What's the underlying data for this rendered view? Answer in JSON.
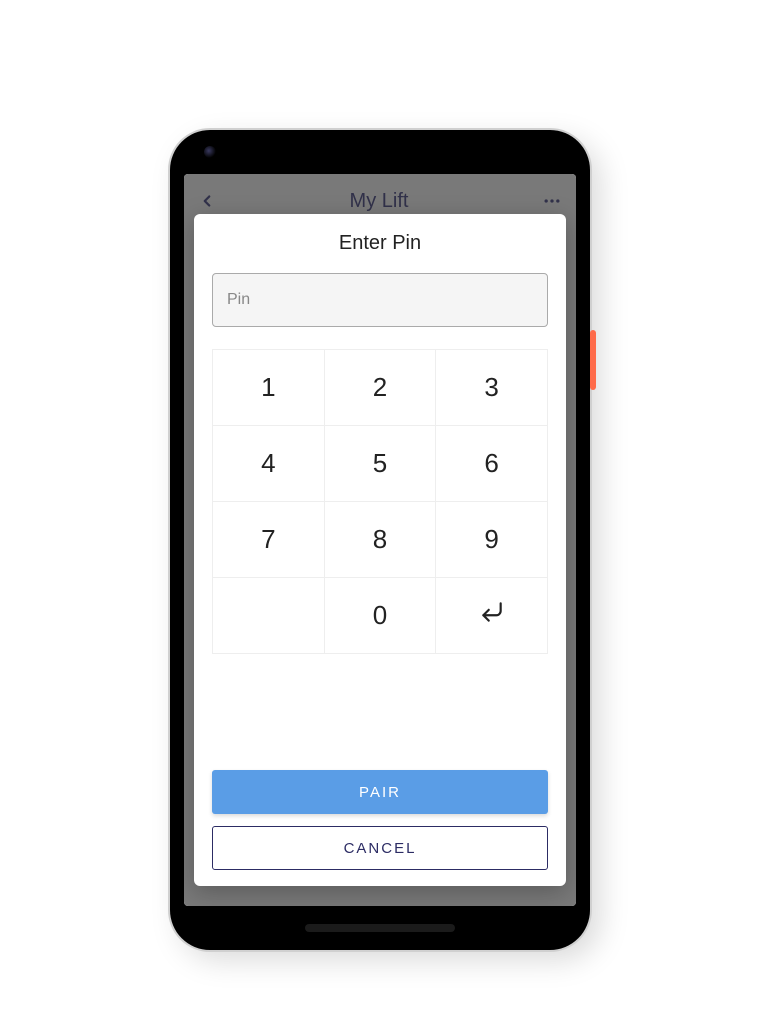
{
  "background_app": {
    "title": "My Lift",
    "back_icon": "chevron-left",
    "more_icon": "more-horizontal"
  },
  "dialog": {
    "title": "Enter Pin",
    "pin_placeholder": "Pin",
    "pin_value": "",
    "keypad": {
      "keys": [
        "1",
        "2",
        "3",
        "4",
        "5",
        "6",
        "7",
        "8",
        "9",
        "",
        "0",
        "enter"
      ]
    },
    "primary_button": "PAIR",
    "secondary_button": "CANCEL"
  },
  "colors": {
    "accent": "#5a9de6",
    "accent_dark": "#2c2c64",
    "side_button": "#ff6b4a"
  }
}
